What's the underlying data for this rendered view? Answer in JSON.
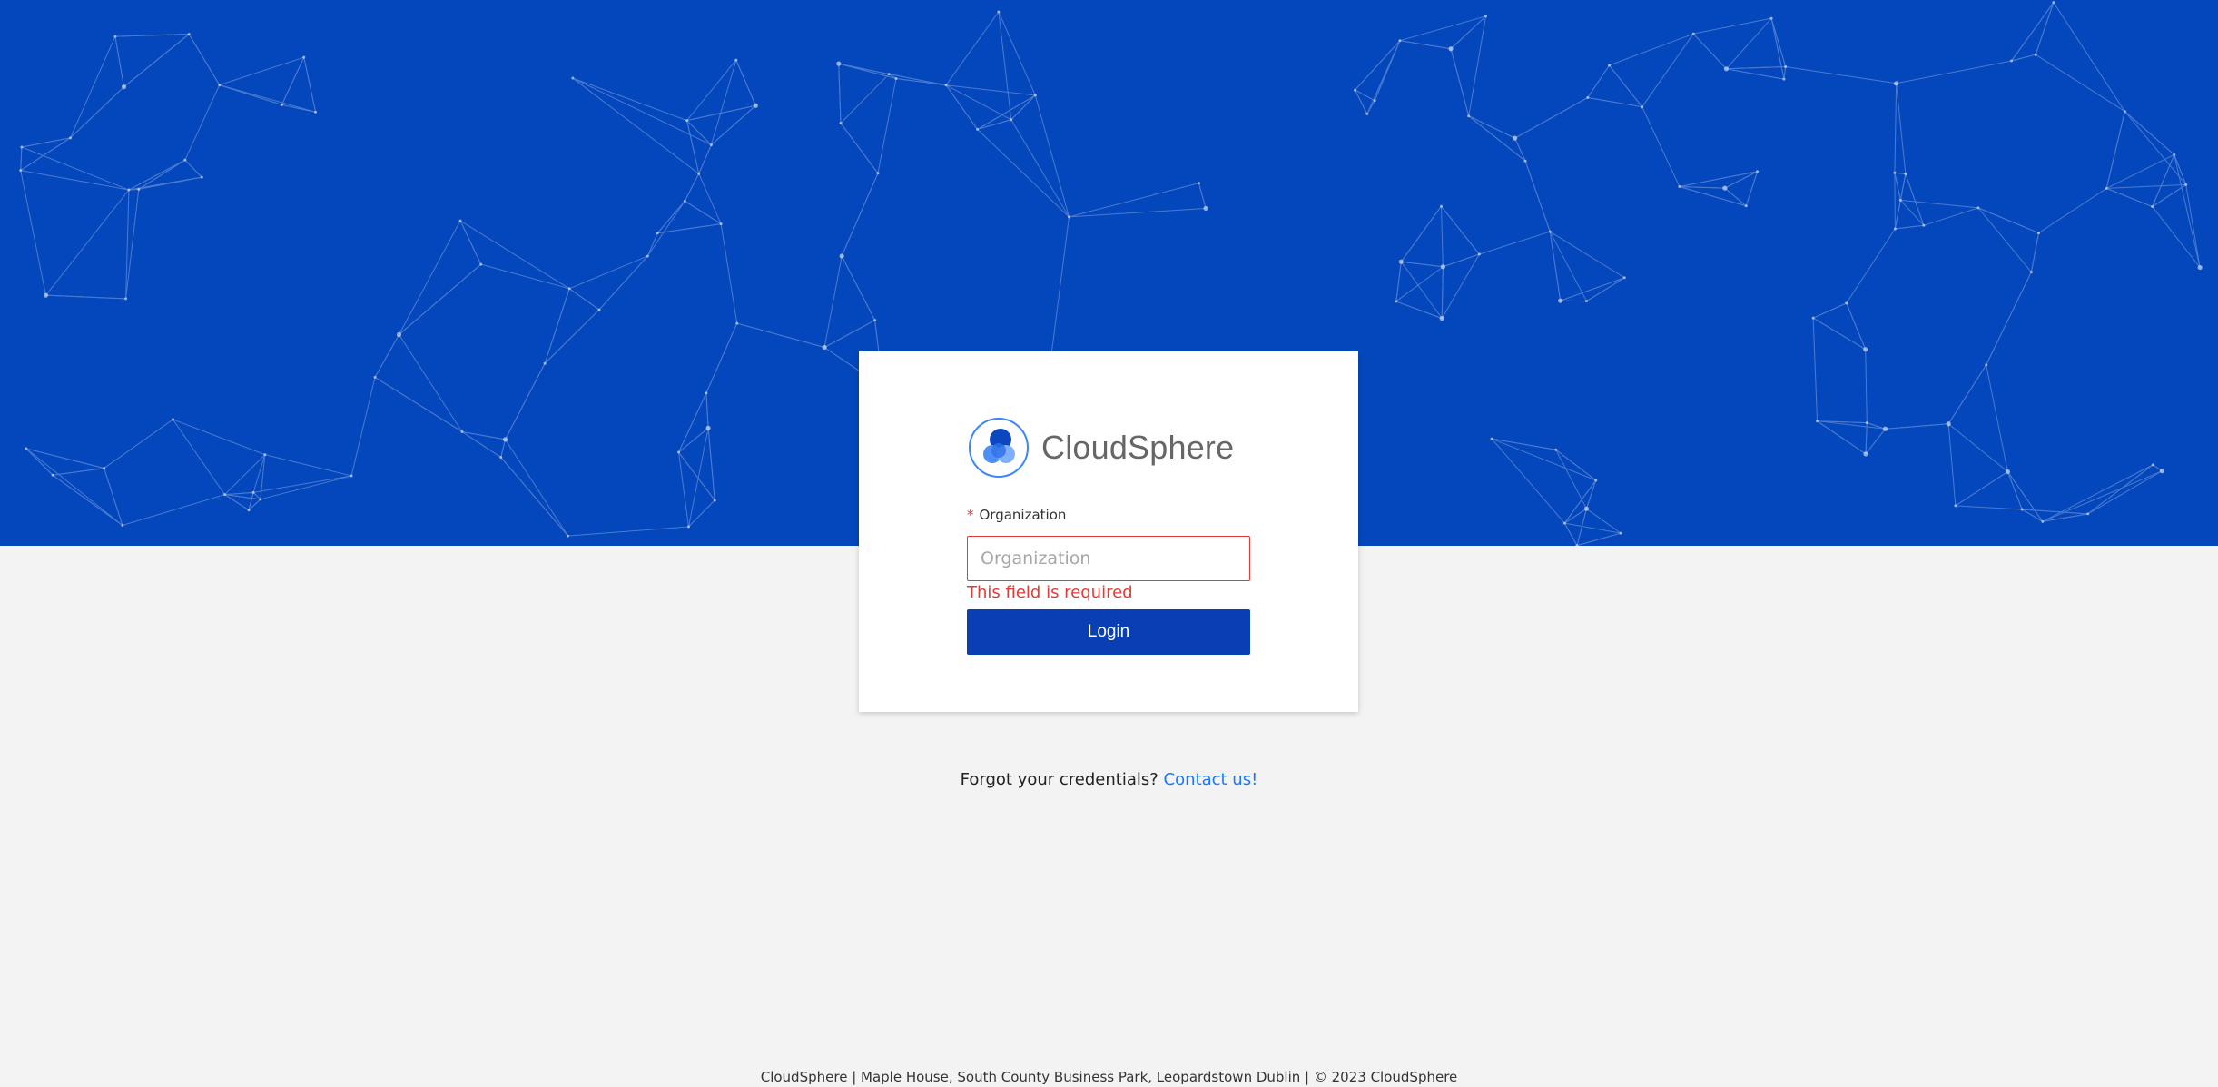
{
  "brand": {
    "name": "CloudSphere",
    "logo_icon": "cloud-globe-icon",
    "color": "#0447bd"
  },
  "login_form": {
    "organization_label": "Organization",
    "required_marker": "*",
    "organization_placeholder": "Organization",
    "organization_value": "",
    "error_message": "This field is required",
    "login_button_label": "Login"
  },
  "help": {
    "forgot_text": "Forgot your credentials?",
    "contact_link": "Contact us!"
  },
  "footer": {
    "text": "CloudSphere | Maple House, South County Business Park, Leopardstown Dublin | © 2023 CloudSphere"
  },
  "colors": {
    "hero_background": "#0447bd",
    "page_background": "#f3f3f3",
    "button": "#0a3fb4",
    "error": "#e53935",
    "link": "#1a78ff"
  }
}
